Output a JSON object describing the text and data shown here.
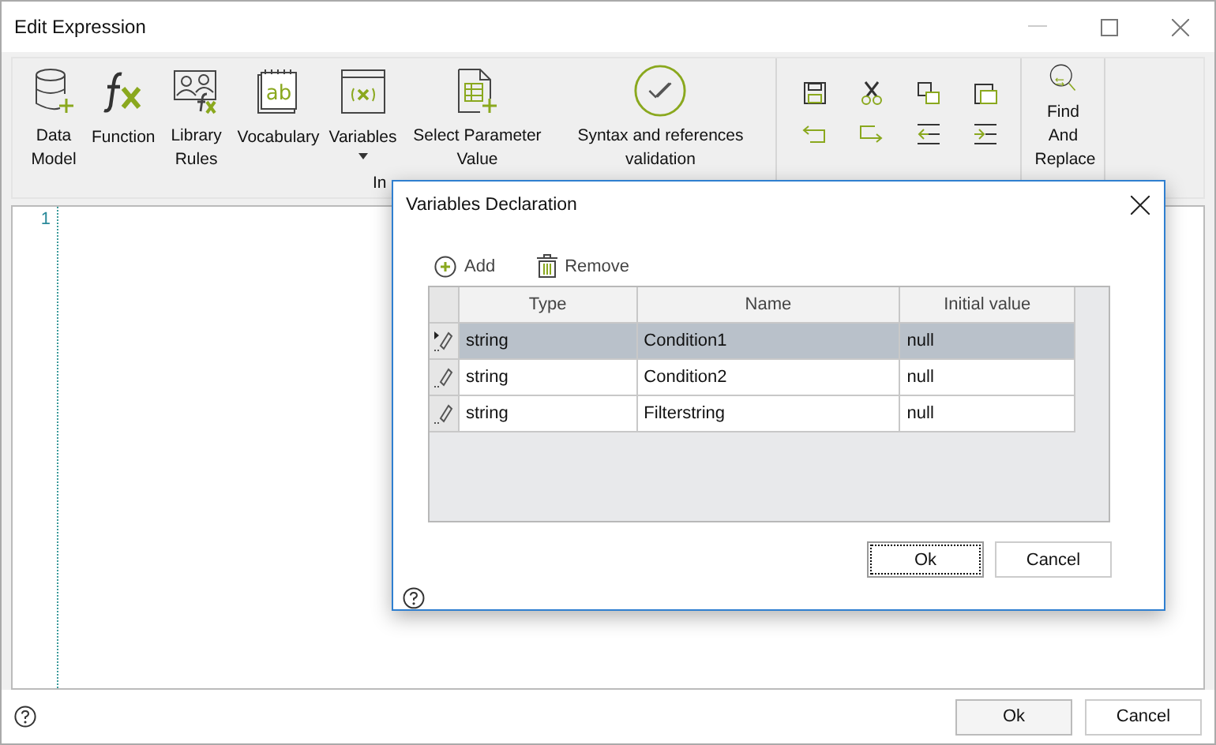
{
  "window": {
    "title": "Edit Expression"
  },
  "ribbon": {
    "groups": [
      {
        "items": [
          {
            "kind": "datamodel",
            "label": "Data Model"
          },
          {
            "kind": "function",
            "label": "Function"
          },
          {
            "kind": "library",
            "label": "Library Rules"
          },
          {
            "kind": "vocabulary",
            "label": "Vocabulary",
            "icon_text": "ab"
          },
          {
            "kind": "variables",
            "label": "Variables",
            "dropdown": true
          },
          {
            "kind": "parameter",
            "label": "Select Parameter Value"
          },
          {
            "kind": "validation",
            "label": "Syntax and references validation"
          }
        ],
        "label": "In"
      },
      {
        "kind": "edit"
      },
      {
        "items": [
          {
            "kind": "find",
            "label": "Find And Replace"
          }
        ]
      }
    ]
  },
  "editor": {
    "line_numbers": [
      "1"
    ]
  },
  "dialog": {
    "title": "Variables Declaration",
    "toolbar": [
      "Add",
      "Remove"
    ],
    "columns": [
      "Type",
      "Name",
      "Initial value"
    ],
    "rows": [
      {
        "type": "string",
        "name": "Condition1",
        "initial_value": "null",
        "selected": true
      },
      {
        "type": "string",
        "name": "Condition2",
        "initial_value": "null",
        "selected": false
      },
      {
        "type": "string",
        "name": "Filterstring",
        "initial_value": "null",
        "selected": false
      }
    ],
    "buttons": [
      "Ok",
      "Cancel"
    ]
  },
  "buttons": [
    "Ok",
    "Cancel"
  ]
}
